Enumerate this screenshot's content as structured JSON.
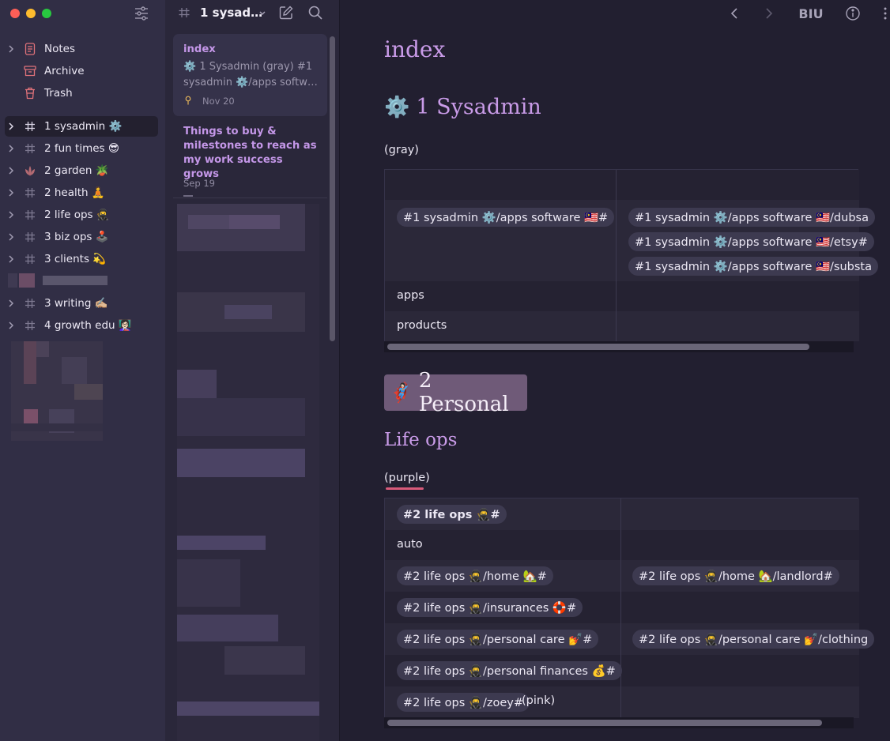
{
  "sidebar": {
    "top_items": [
      {
        "label": "Notes",
        "icon": "notes-icon"
      },
      {
        "label": "Archive",
        "icon": "archive-icon"
      },
      {
        "label": "Trash",
        "icon": "trash-icon"
      }
    ],
    "tags": [
      {
        "label": "1 sysadmin ⚙️",
        "icon": "tag-icon",
        "active": true
      },
      {
        "label": "2 fun times 😎",
        "icon": "tag-icon"
      },
      {
        "label": "2 garden 🪴",
        "icon": "plant-icon"
      },
      {
        "label": "2 health 🧘",
        "icon": "tag-icon"
      },
      {
        "label": "2 life ops 🥷",
        "icon": "tag-icon"
      },
      {
        "label": "3 biz ops 🕹️",
        "icon": "tag-icon"
      },
      {
        "label": "3 clients 💫",
        "icon": "tag-icon"
      },
      {
        "label": "3 writing ✍🏼",
        "icon": "tag-icon"
      },
      {
        "label": "4 growth edu 👩🏻‍🏫",
        "icon": "tag-icon"
      }
    ]
  },
  "notelist": {
    "title": "1 sysad…",
    "notes": [
      {
        "title": "index",
        "snippet": "⚙️ 1 Sysadmin (gray) #1 sysadmin ⚙️/apps softw…",
        "date": "Nov 20",
        "pinned": true
      },
      {
        "title": "Things to buy & milestones to reach as my work success grows",
        "date": "Sep 19"
      }
    ]
  },
  "toolbar": {
    "format_label": "BIU"
  },
  "editor": {
    "title": "index",
    "section1": {
      "heading": "1 Sysadmin",
      "emoji": "⚙️",
      "note": "(gray)"
    },
    "table1": {
      "r1c1": "#1 sysadmin ⚙️/apps software 🇲🇾#",
      "r1c2": [
        "#1 sysadmin ⚙️/apps software 🇲🇾/dubsa",
        "#1 sysadmin ⚙️/apps software 🇲🇾/etsy#",
        "#1 sysadmin ⚙️/apps software 🇲🇾/substa"
      ],
      "r2c1": "apps",
      "r3c1": "products"
    },
    "section2": {
      "heading": "2 Personal",
      "emoji": "🦸🏻‍♀️"
    },
    "section3": {
      "heading": "Life ops",
      "note": "(purple)"
    },
    "table2": {
      "r1c1": "#2 life ops 🥷#",
      "r2c1": "auto",
      "r3c1": "#2 life ops 🥷/home 🏡#",
      "r3c2": "#2 life ops 🥷/home 🏡/landlord#",
      "r4c1": "#2 life ops 🥷/insurances 🛟#",
      "r5c1": "#2 life ops 🥷/personal care 💅#",
      "r5c2": "#2 life ops 🥷/personal care 💅/clothing",
      "r6c1": "#2 life ops 🥷/personal finances 💰#",
      "r7c1": "#2 life ops 🥷/zoey#",
      "r7note": "(pink)"
    }
  },
  "colors": {
    "accent": "#c99be8",
    "sidebar_bg": "#312e45",
    "editor_bg": "#221f30",
    "pill_bg": "#3d3a50"
  }
}
